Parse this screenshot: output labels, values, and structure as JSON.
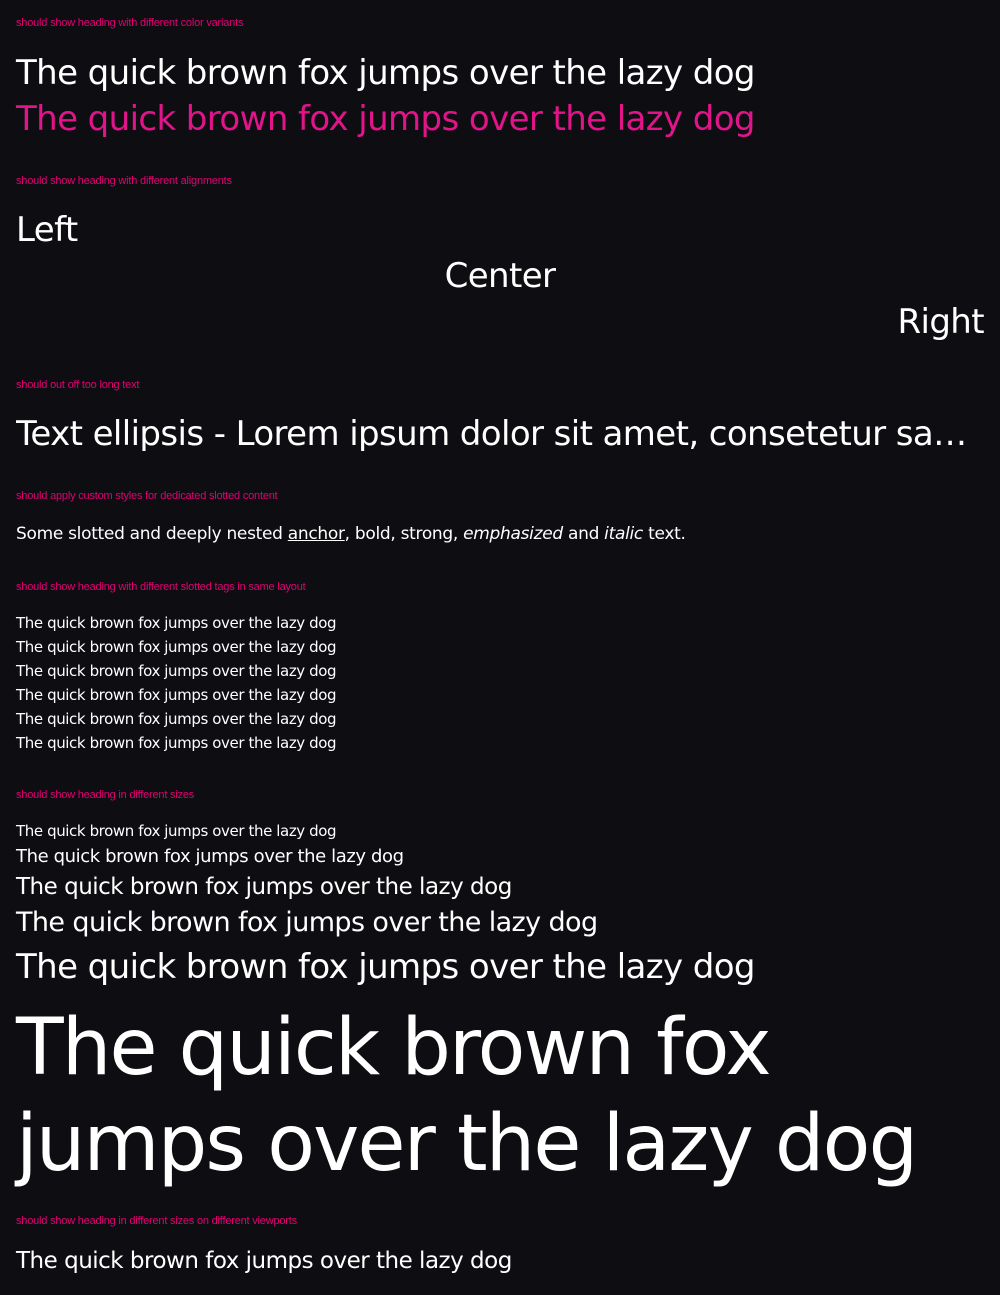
{
  "sections": {
    "color_variants": {
      "label": "should show heading with different color variants",
      "default_text": "The quick brown fox jumps over the lazy dog",
      "magenta_text": "The quick brown fox jumps over the lazy dog"
    },
    "alignments": {
      "label": "should show heading with different alignments",
      "left": "Left",
      "center": "Center",
      "right": "Right"
    },
    "ellipsis": {
      "label": "should out off too long text",
      "text": "Text ellipsis - Lorem ipsum dolor sit amet, consetetur sadipscing elitr, sed diam nonumy eirmod tempor invidunt ut labore et dolore magna"
    },
    "slotted_content": {
      "label": "should apply custom styles for dedicated slotted content",
      "part1": "Some slotted and deeply nested ",
      "anchor": "anchor",
      "part2": ", bold, strong, ",
      "emphasized": "emphasized",
      "part3": " and ",
      "italic": "italic",
      "part4": " text."
    },
    "slotted_tags": {
      "label": "should show heading with different slotted tags in same layout",
      "rows": [
        "The quick brown fox jumps over the lazy dog",
        "The quick brown fox jumps over the lazy dog",
        "The quick brown fox jumps over the lazy dog",
        "The quick brown fox jumps over the lazy dog",
        "The quick brown fox jumps over the lazy dog",
        "The quick brown fox jumps over the lazy dog"
      ]
    },
    "sizes": {
      "label": "should show heading in different sizes",
      "rows": [
        "The quick brown fox jumps over the lazy dog",
        "The quick brown fox jumps over the lazy dog",
        "The quick brown fox jumps over the lazy dog",
        "The quick brown fox jumps over the lazy dog",
        "The quick brown fox jumps over the lazy dog",
        "The quick brown fox jumps over the lazy dog"
      ]
    },
    "viewports": {
      "label": "should show heading in different sizes on different viewports",
      "text": "The quick brown fox jumps over the lazy dog"
    }
  },
  "colors": {
    "background": "#0e0e12",
    "text": "#ffffff",
    "accent": "#e2148a",
    "label": "#e20074"
  }
}
